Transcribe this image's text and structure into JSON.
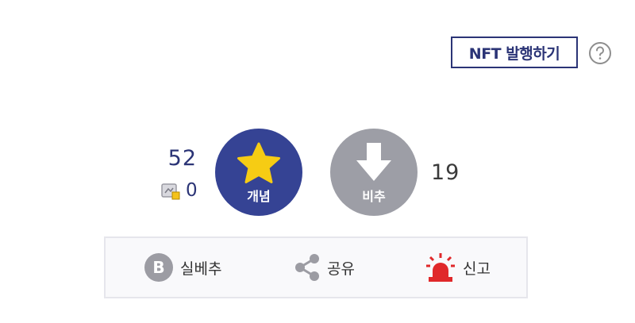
{
  "nft": {
    "button_label": "NFT 발행하기",
    "help_icon": "question-circle-icon"
  },
  "votes": {
    "up_count": "52",
    "fixed_count": "0",
    "up_label": "개념",
    "down_label": "비추",
    "down_count": "19",
    "up_icon": "star-icon",
    "down_icon": "arrow-down-icon",
    "fixed_icon": "fixed-account-icon"
  },
  "actions": {
    "best_label": "실베추",
    "best_icon": "b-circle-icon",
    "share_label": "공유",
    "share_icon": "share-icon",
    "report_label": "신고",
    "report_icon": "siren-icon"
  },
  "colors": {
    "navy": "#354394",
    "gray": "#9d9ea6",
    "star": "#f6cc14",
    "siren": "#e0282a"
  }
}
